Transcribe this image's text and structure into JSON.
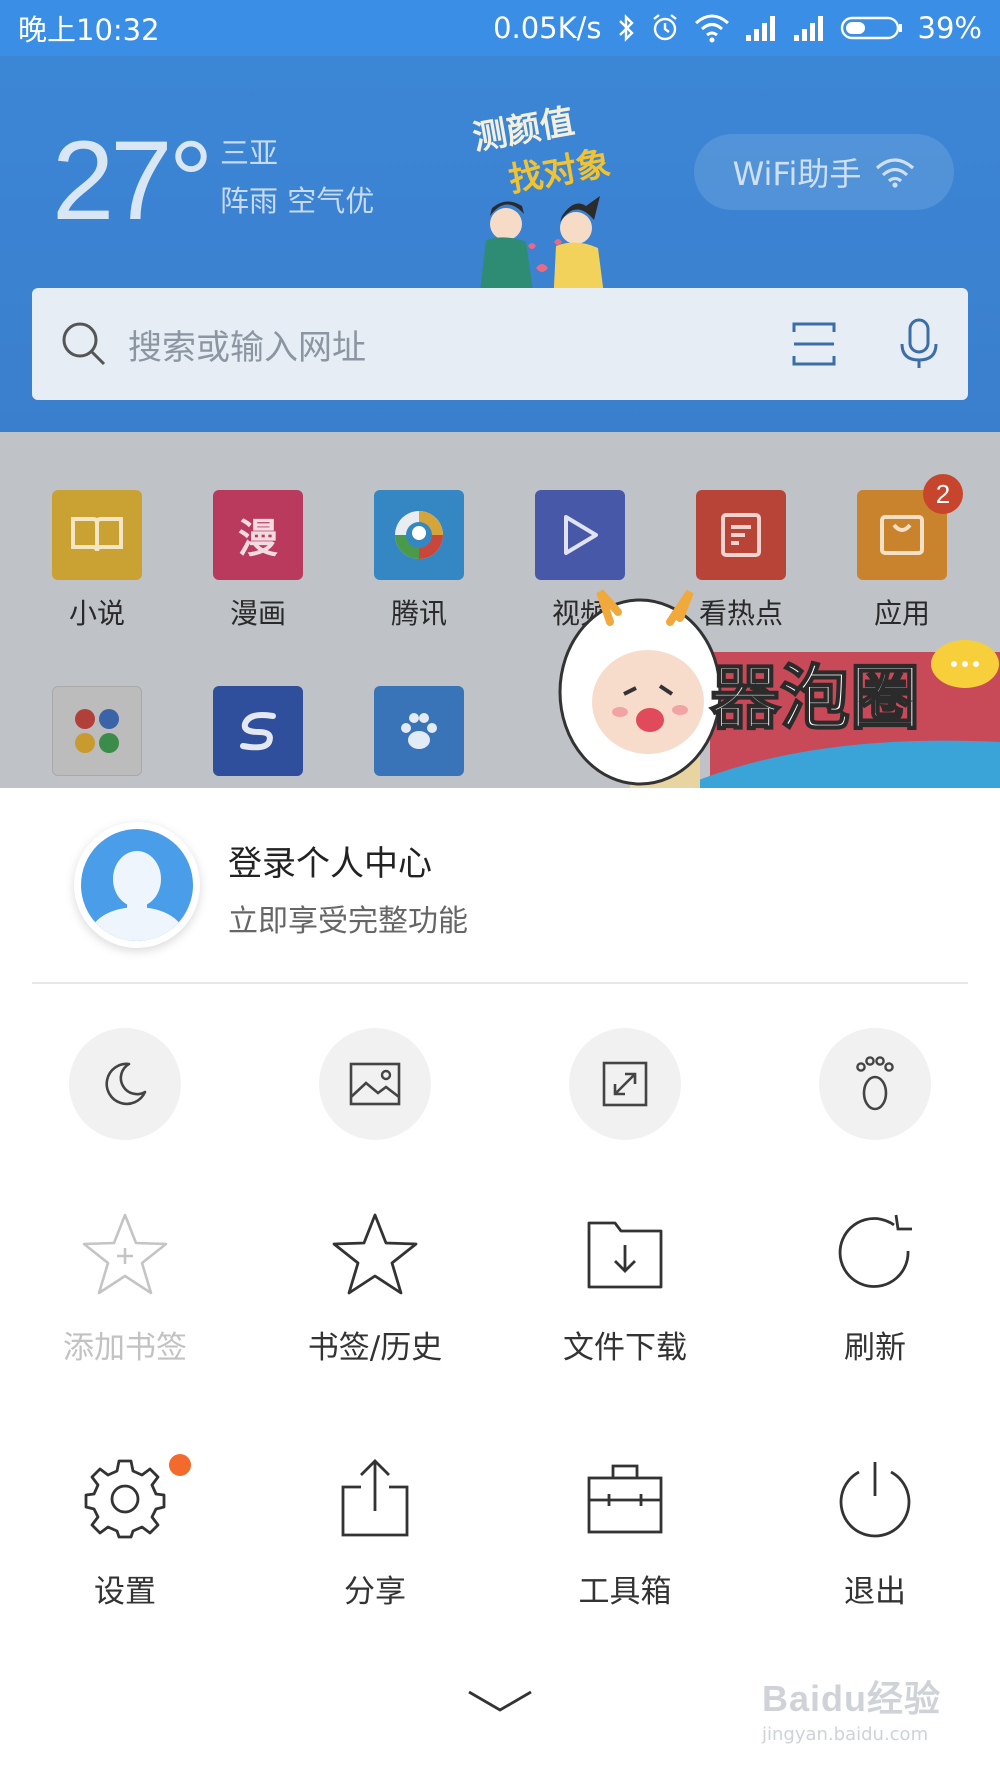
{
  "status_bar": {
    "time": "晚上10:32",
    "net_speed": "0.05K/s",
    "battery": "39%",
    "battery_level": 0.39
  },
  "header": {
    "temperature": "27°",
    "city": "三亚",
    "condition": "阵雨 空气优",
    "promo_line1": "测颜值",
    "promo_line2": "找对象",
    "wifi_label": "WiFi助手",
    "search_placeholder": "搜索或输入网址"
  },
  "apps": [
    {
      "label": "小说",
      "color": "#c9a233",
      "icon": "book-icon"
    },
    {
      "label": "漫画",
      "color": "#b93a5c",
      "icon": "comic-icon",
      "glyph": "漫"
    },
    {
      "label": "腾讯",
      "color": "#3587c4",
      "icon": "tencent-news-icon"
    },
    {
      "label": "视频",
      "color": "#4858a9",
      "icon": "play-icon"
    },
    {
      "label": "看热点",
      "color": "#b84438",
      "icon": "news-icon"
    },
    {
      "label": "应用",
      "color": "#c9832d",
      "icon": "app-store-icon",
      "badge": "2"
    }
  ],
  "mascot_text": "器泡圈",
  "account": {
    "title": "登录个人中心",
    "subtitle": "立即享受完整功能"
  },
  "quick_toggles": [
    "moon-icon",
    "image-icon",
    "fullscreen-icon",
    "footprint-icon"
  ],
  "menu": {
    "add_bookmark": "添加书签",
    "bookmarks_history": "书签/历史",
    "downloads": "文件下载",
    "refresh": "刷新",
    "settings": "设置",
    "share": "分享",
    "toolbox": "工具箱",
    "exit": "退出"
  },
  "watermark": {
    "brand": "Baidu经验",
    "url": "jingyan.baidu.com"
  }
}
